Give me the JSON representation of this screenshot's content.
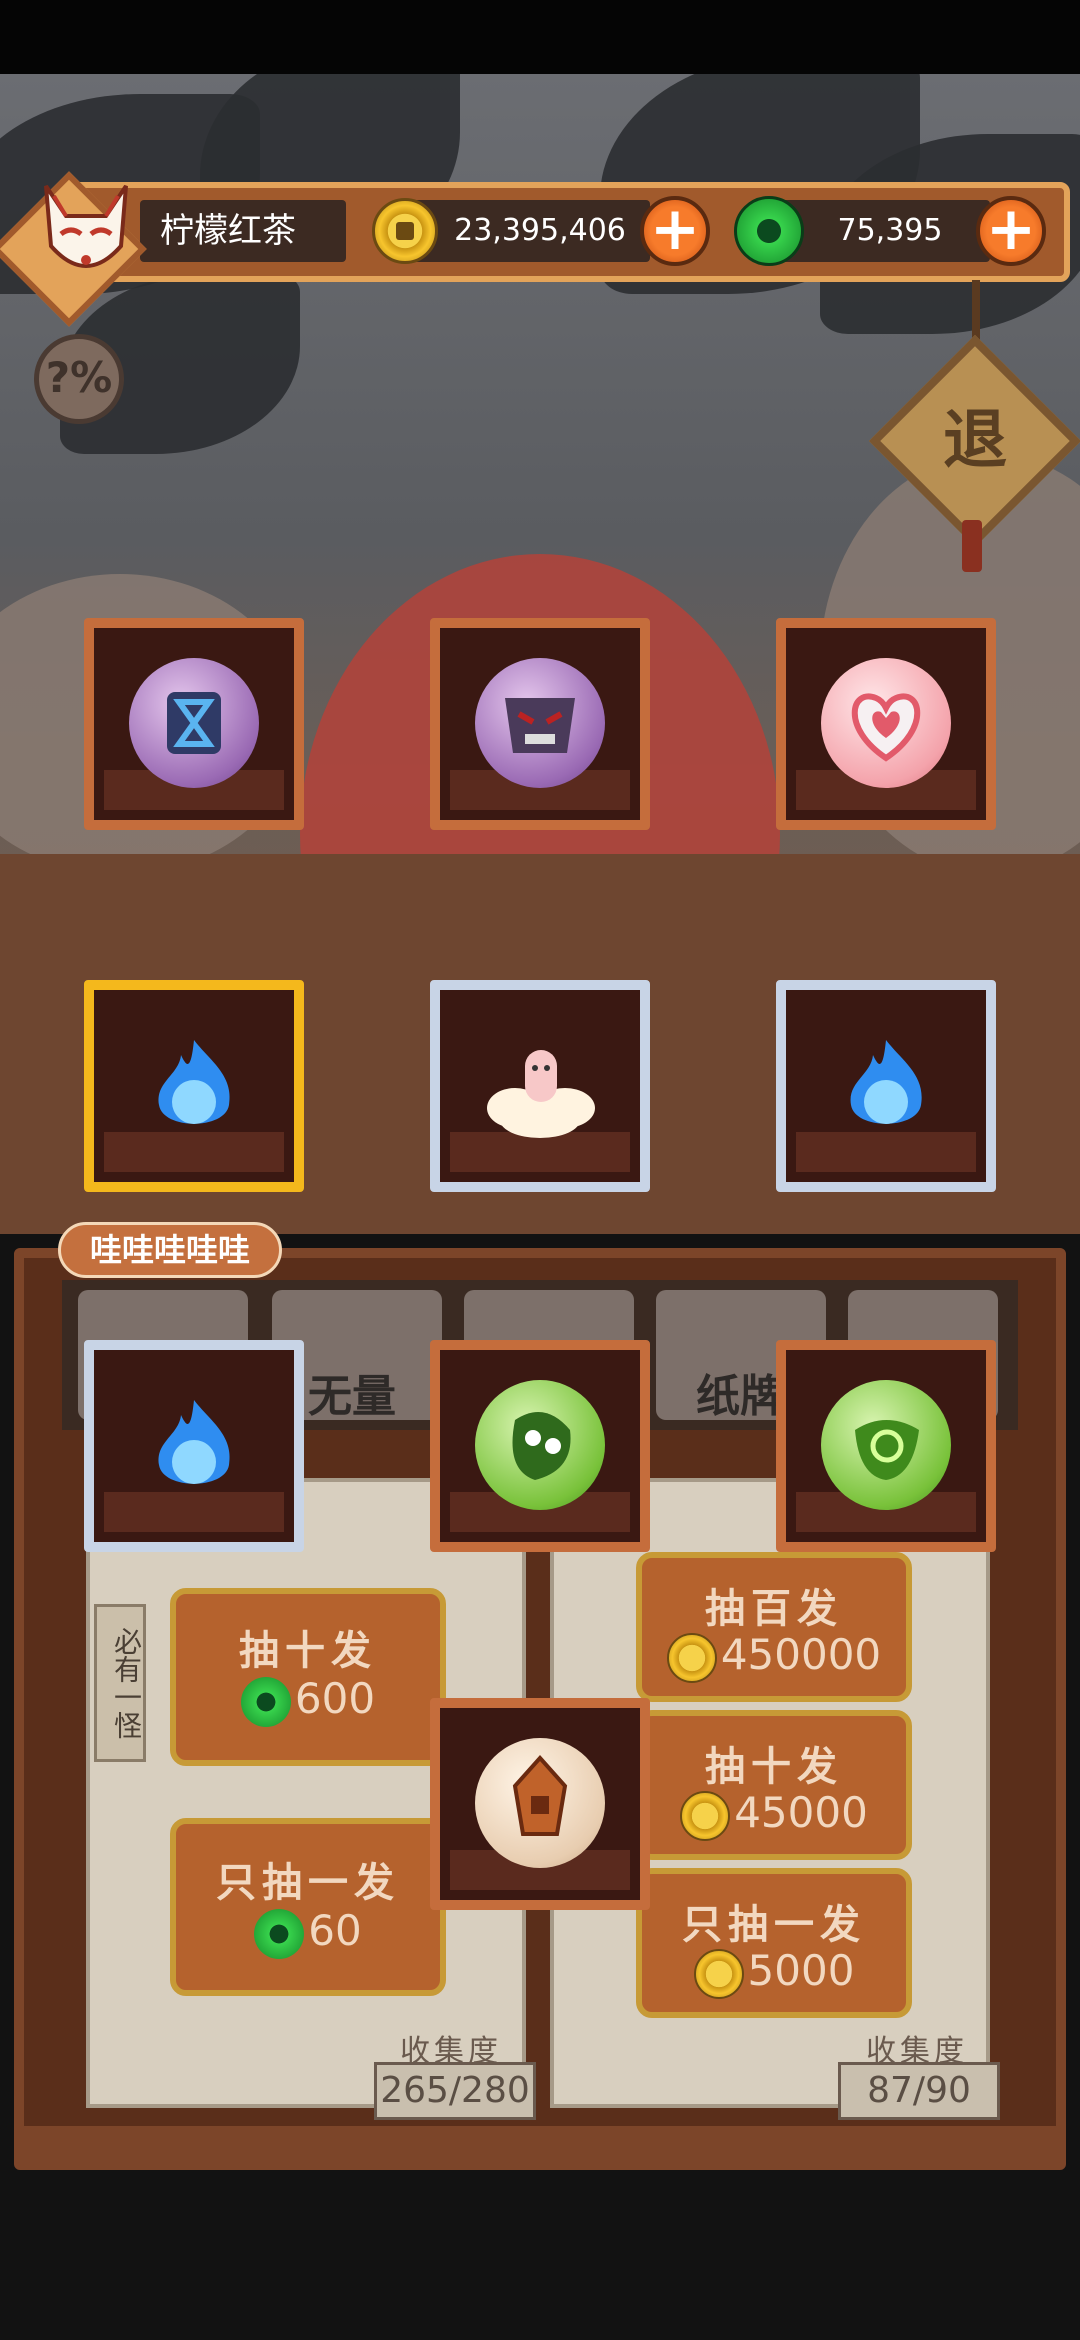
{
  "player": {
    "name": "柠檬红茶"
  },
  "currency": {
    "coins": "23,395,406",
    "jade": "75,395",
    "coin_icon": "gold-coin-icon",
    "jade_icon": "jade-coin-icon"
  },
  "buttons": {
    "help": "?%",
    "exit": "退",
    "add_coins": "+",
    "add_jade": "+"
  },
  "bubble": "哇哇哇哇哇",
  "tabs": [
    {
      "label": "无量"
    },
    {
      "label": "纸牌"
    }
  ],
  "side_tag": "必有一怪",
  "left_panel": {
    "draw_ten": {
      "title": "抽十发",
      "price": "600",
      "currency_icon": "jade-coin-icon"
    },
    "draw_one": {
      "title": "只抽一发",
      "price": "60",
      "currency_icon": "jade-coin-icon"
    },
    "collection_label": "收集度",
    "collection_count": "265/280"
  },
  "right_panel": {
    "draw_hundred": {
      "title": "抽百发",
      "price": "450000",
      "currency_icon": "gold-coin-icon"
    },
    "draw_ten": {
      "title": "抽十发",
      "price": "45000",
      "currency_icon": "gold-coin-icon"
    },
    "draw_one": {
      "title": "只抽一发",
      "price": "5000",
      "currency_icon": "gold-coin-icon"
    },
    "collection_label": "收集度",
    "collection_count": "87/90"
  },
  "slots": [
    {
      "item": "hourglass-orb-icon",
      "frame": "bronze"
    },
    {
      "item": "demon-mask-orb-icon",
      "frame": "bronze"
    },
    {
      "item": "heart-orb-icon",
      "frame": "bronze"
    },
    {
      "item": "blue-flame-icon",
      "frame": "gold"
    },
    {
      "item": "ghost-cloud-icon",
      "frame": "silver"
    },
    {
      "item": "blue-flame-icon",
      "frame": "silver"
    },
    {
      "item": "blue-flame-icon",
      "frame": "silver"
    },
    {
      "item": "green-creature-orb-icon",
      "frame": "bronze"
    },
    {
      "item": "green-spirit-orb-icon",
      "frame": "bronze"
    },
    {
      "item": "lantern-orb-icon",
      "frame": "bronze"
    }
  ],
  "colors": {
    "wood": "#c56d3c",
    "gold_frame": "#f4b81c",
    "silver_frame": "#c8d4e6",
    "button": "#b5622d",
    "text_light": "#f2d8c0"
  }
}
